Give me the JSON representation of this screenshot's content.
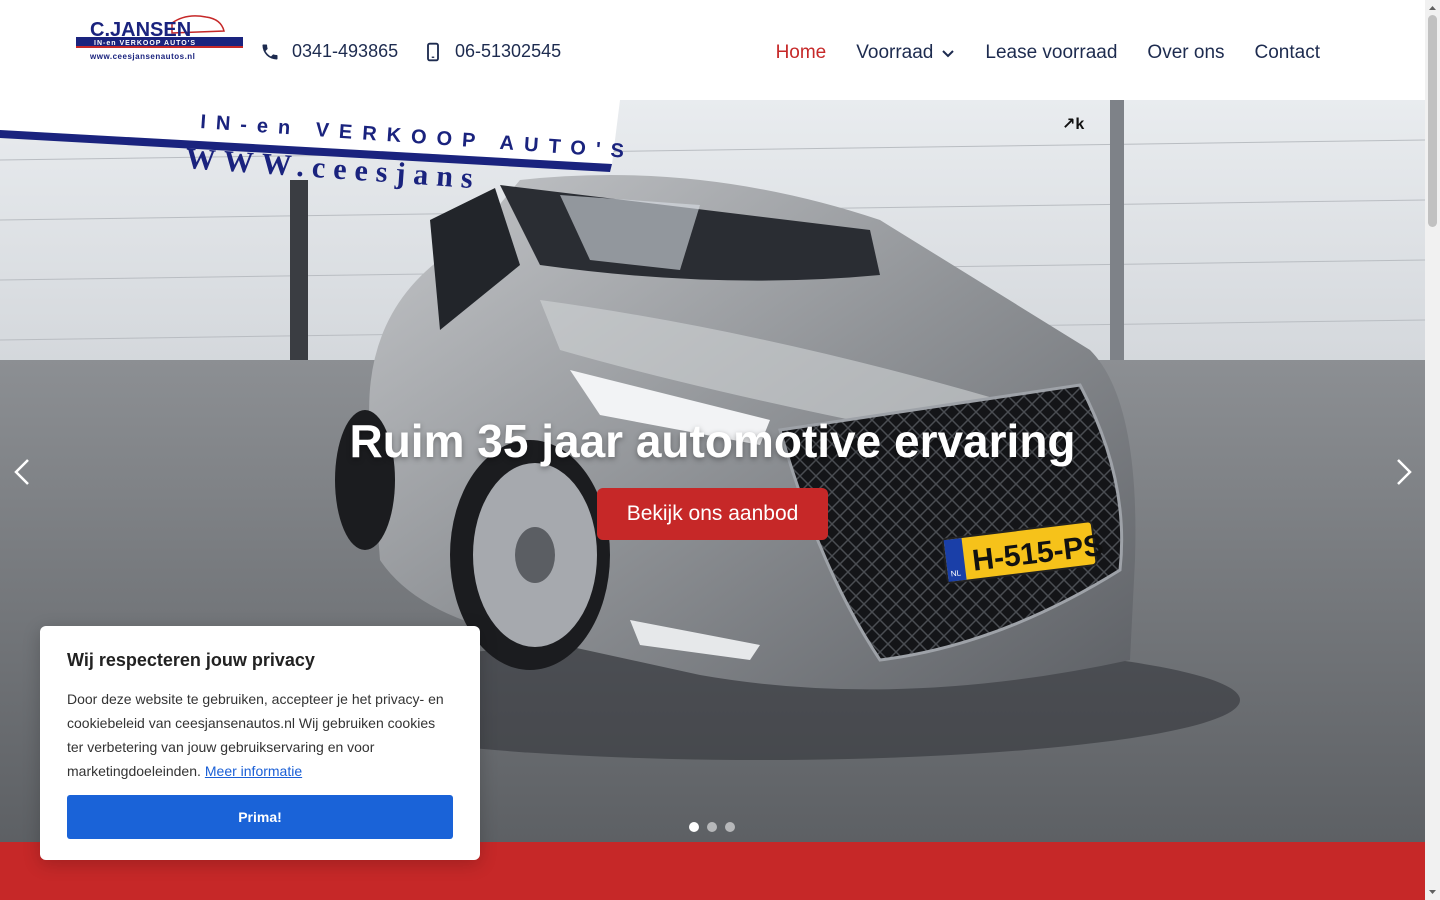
{
  "header": {
    "logo_text": "C.JANSEN",
    "logo_tagline": "IN-en VERKOOP AUTO'S",
    "logo_url_text": "www.ceesjansenautos.nl",
    "phone_landline": "0341-493865",
    "phone_mobile": "06-51302545"
  },
  "nav": {
    "items": [
      {
        "label": "Home",
        "active": true
      },
      {
        "label": "Voorraad",
        "dropdown": true
      },
      {
        "label": "Lease voorraad"
      },
      {
        "label": "Over ons"
      },
      {
        "label": "Contact"
      }
    ]
  },
  "hero": {
    "title": "Ruim 35 jaar automotive ervaring",
    "cta_label": "Bekijk ons aanbod",
    "sign_line1": "IN-en VERKOOP AUTO'S",
    "sign_line2": "WWW.ceesjans",
    "plate": "H-515-PS",
    "plate_country": "NL",
    "badge": "↗k",
    "slides_count": 3,
    "active_slide": 1
  },
  "cookie": {
    "title": "Wij respecteren jouw privacy",
    "body": "Door deze website te gebruiken, accepteer je het privacy- en cookiebeleid van ceesjansenautos.nl Wij gebruiken cookies ter verbetering van jouw gebruikservaring en voor marketingdoeleinden.",
    "link": "Meer informatie",
    "button": "Prima!"
  },
  "colors": {
    "accent_red": "#c62828",
    "nav_text": "#1d2b4f",
    "cookie_button": "#1a63d8"
  }
}
